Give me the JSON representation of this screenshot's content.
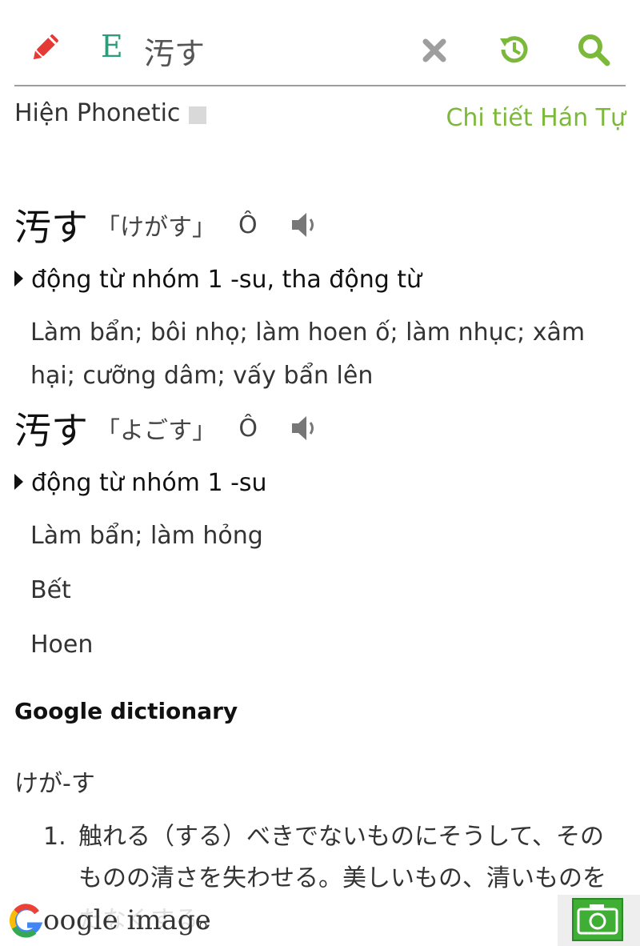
{
  "toolbar": {
    "lang_code": "E",
    "query": "汚す",
    "colors": {
      "pencil": "#e53935",
      "accent": "#7cb83a",
      "lang": "#2e9c7a",
      "clear": "#9e9e9e"
    }
  },
  "options": {
    "phonetic_label": "Hiện Phonetic",
    "phonetic_checked": false,
    "han_detail_link": "Chi tiết Hán Tự"
  },
  "entries": [
    {
      "word": "汚す",
      "reading": "「けがす」",
      "mark": "Ô",
      "pos": "động từ nhóm 1 -su, tha động từ",
      "meanings": [
        "Làm bẩn; bôi nhọ; làm hoen ố; làm nhục; xâm hại; cưỡng dâm; vấy bẩn lên"
      ]
    },
    {
      "word": "汚す",
      "reading": "「よごす」",
      "mark": "Ô",
      "pos": "động từ nhóm 1 -su",
      "meanings": [
        "Làm bẩn; làm hỏng",
        "Bết",
        "Hoen"
      ]
    }
  ],
  "google_dictionary": {
    "title": "Google dictionary",
    "word": "けが-す",
    "definitions": [
      {
        "num": "1.",
        "text": "触れる（する）べきでないものにそうして、そのものの清さを失わせる。美しいもの、清いものをたなくする。"
      }
    ]
  },
  "google_image": {
    "label": "oogle image"
  }
}
